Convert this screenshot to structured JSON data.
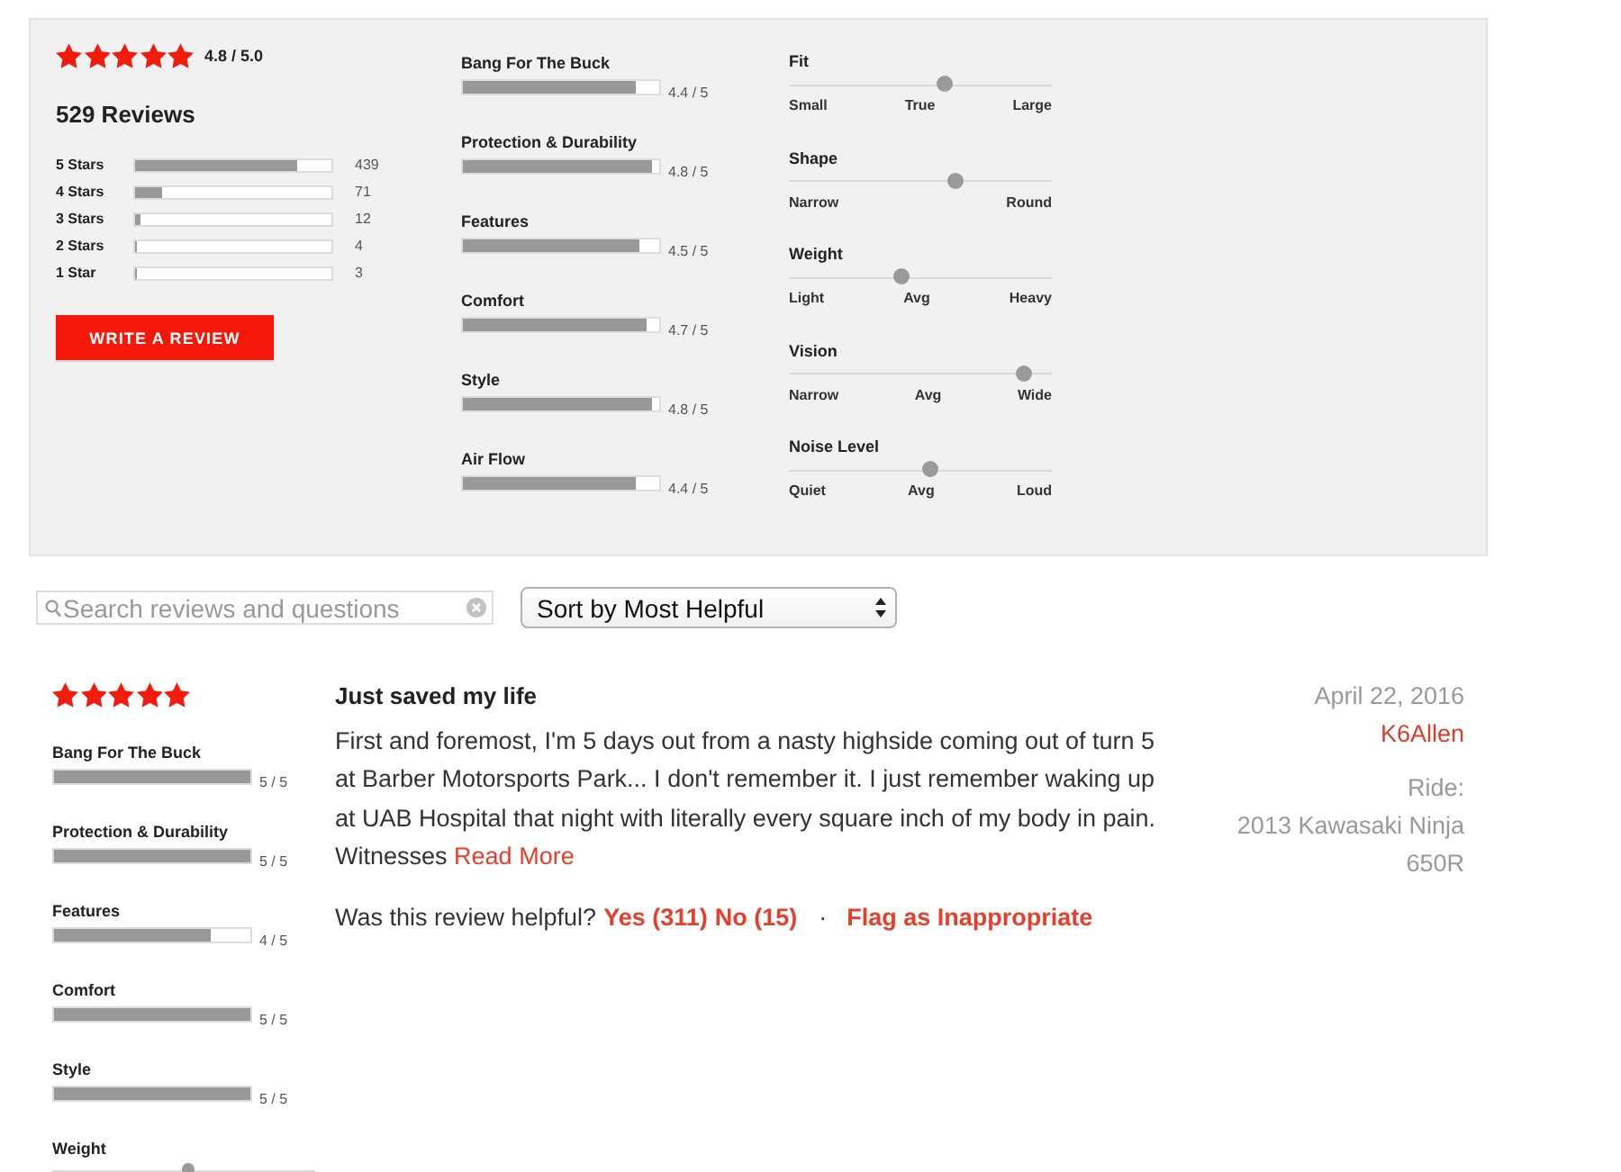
{
  "summary": {
    "stars": 5,
    "average": "4.8 / 5.0",
    "review_count": "529 Reviews",
    "histogram": [
      {
        "label": "5 Stars",
        "level": 0.83,
        "count": "439"
      },
      {
        "label": "4 Stars",
        "level": 0.134,
        "count": "71"
      },
      {
        "label": "3 Stars",
        "level": 0.023,
        "count": "12"
      },
      {
        "label": "2 Stars",
        "level": 0.008,
        "count": "4"
      },
      {
        "label": "1 Star",
        "level": 0.006,
        "count": "3"
      }
    ],
    "write_button": "WRITE A REVIEW",
    "ratings": [
      {
        "label": "Bang For The Buck",
        "level": 0.88,
        "value": "4.4 / 5"
      },
      {
        "label": "Protection & Durability",
        "level": 0.96,
        "value": "4.8 / 5"
      },
      {
        "label": "Features",
        "level": 0.9,
        "value": "4.5 / 5"
      },
      {
        "label": "Comfort",
        "level": 0.94,
        "value": "4.7 / 5"
      },
      {
        "label": "Style",
        "level": 0.96,
        "value": "4.8 / 5"
      },
      {
        "label": "Air Flow",
        "level": 0.88,
        "value": "4.4 / 5"
      }
    ],
    "scales": [
      {
        "label": "Fit",
        "level": 0.6,
        "marks": [
          "Small",
          "True",
          "Large"
        ]
      },
      {
        "label": "Shape",
        "level": 0.64,
        "marks": [
          "Narrow",
          "Round"
        ]
      },
      {
        "label": "Weight",
        "level": 0.42,
        "marks": [
          "Light",
          "Avg",
          "Heavy"
        ]
      },
      {
        "label": "Vision",
        "level": 0.92,
        "marks": [
          "Narrow",
          "Avg",
          "Wide"
        ]
      },
      {
        "label": "Noise Level",
        "level": 0.54,
        "marks": [
          "Quiet",
          "Avg",
          "Loud"
        ]
      }
    ]
  },
  "search": {
    "placeholder": "Search reviews and questions"
  },
  "sort": {
    "value": "Sort by Most Helpful"
  },
  "review": {
    "stars": 5,
    "ratings": [
      {
        "kind": "bar",
        "label": "Bang For The Buck",
        "level": 1,
        "value": "5 / 5"
      },
      {
        "kind": "bar",
        "label": "Protection & Durability",
        "level": 1,
        "value": "5 / 5"
      },
      {
        "kind": "bar",
        "label": "Features",
        "level": 0.8,
        "value": "4 / 5"
      },
      {
        "kind": "bar",
        "label": "Comfort",
        "level": 1,
        "value": "5 / 5"
      },
      {
        "kind": "bar",
        "label": "Style",
        "level": 1,
        "value": "5 / 5"
      },
      {
        "kind": "slider",
        "label": "Weight",
        "level": 0.52
      }
    ],
    "title": "Just saved my life",
    "body": "First and foremost, I'm 5 days out from a nasty highside coming out of turn 5 at Barber Motorsports Park... I don't remember it. I just remember waking up at UAB Hospital that night with literally every square inch of my body in pain. Witnesses",
    "read_more": "Read More",
    "helpful_prompt": "Was this review helpful?",
    "yes": "Yes (311)",
    "no": "No (15)",
    "separator": "·",
    "flag": "Flag as Inappropriate",
    "date": "April 22, 2016",
    "author": "K6Allen",
    "ride_label": "Ride:",
    "ride": "2013 Kawasaki Ninja 650R"
  }
}
